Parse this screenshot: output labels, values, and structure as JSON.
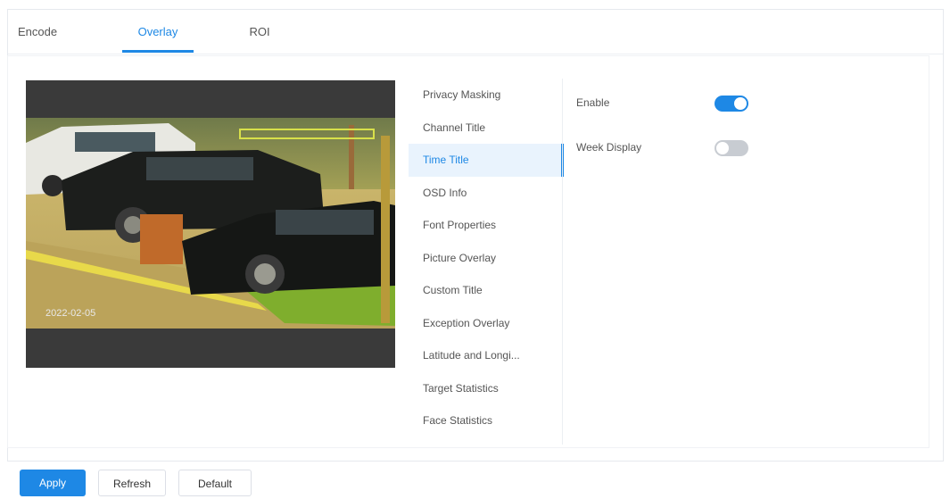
{
  "tabs": [
    {
      "label": "Encode"
    },
    {
      "label": "Overlay",
      "active": true
    },
    {
      "label": "ROI"
    }
  ],
  "video": {
    "osd_time_text": "2022-02-05"
  },
  "menu": [
    {
      "label": "Privacy Masking"
    },
    {
      "label": "Channel Title"
    },
    {
      "label": "Time Title",
      "active": true
    },
    {
      "label": "OSD Info"
    },
    {
      "label": "Font Properties"
    },
    {
      "label": "Picture Overlay"
    },
    {
      "label": "Custom Title"
    },
    {
      "label": "Exception Overlay"
    },
    {
      "label": "Latitude and Longi..."
    },
    {
      "label": "Target Statistics"
    },
    {
      "label": "Face Statistics"
    }
  ],
  "settings": {
    "enable": {
      "label": "Enable",
      "value": true
    },
    "week_display": {
      "label": "Week Display",
      "value": false
    }
  },
  "buttons": {
    "apply": "Apply",
    "refresh": "Refresh",
    "default": "Default"
  },
  "colors": {
    "accent": "#1e88e5",
    "toggle_off": "#c8ccd2"
  }
}
